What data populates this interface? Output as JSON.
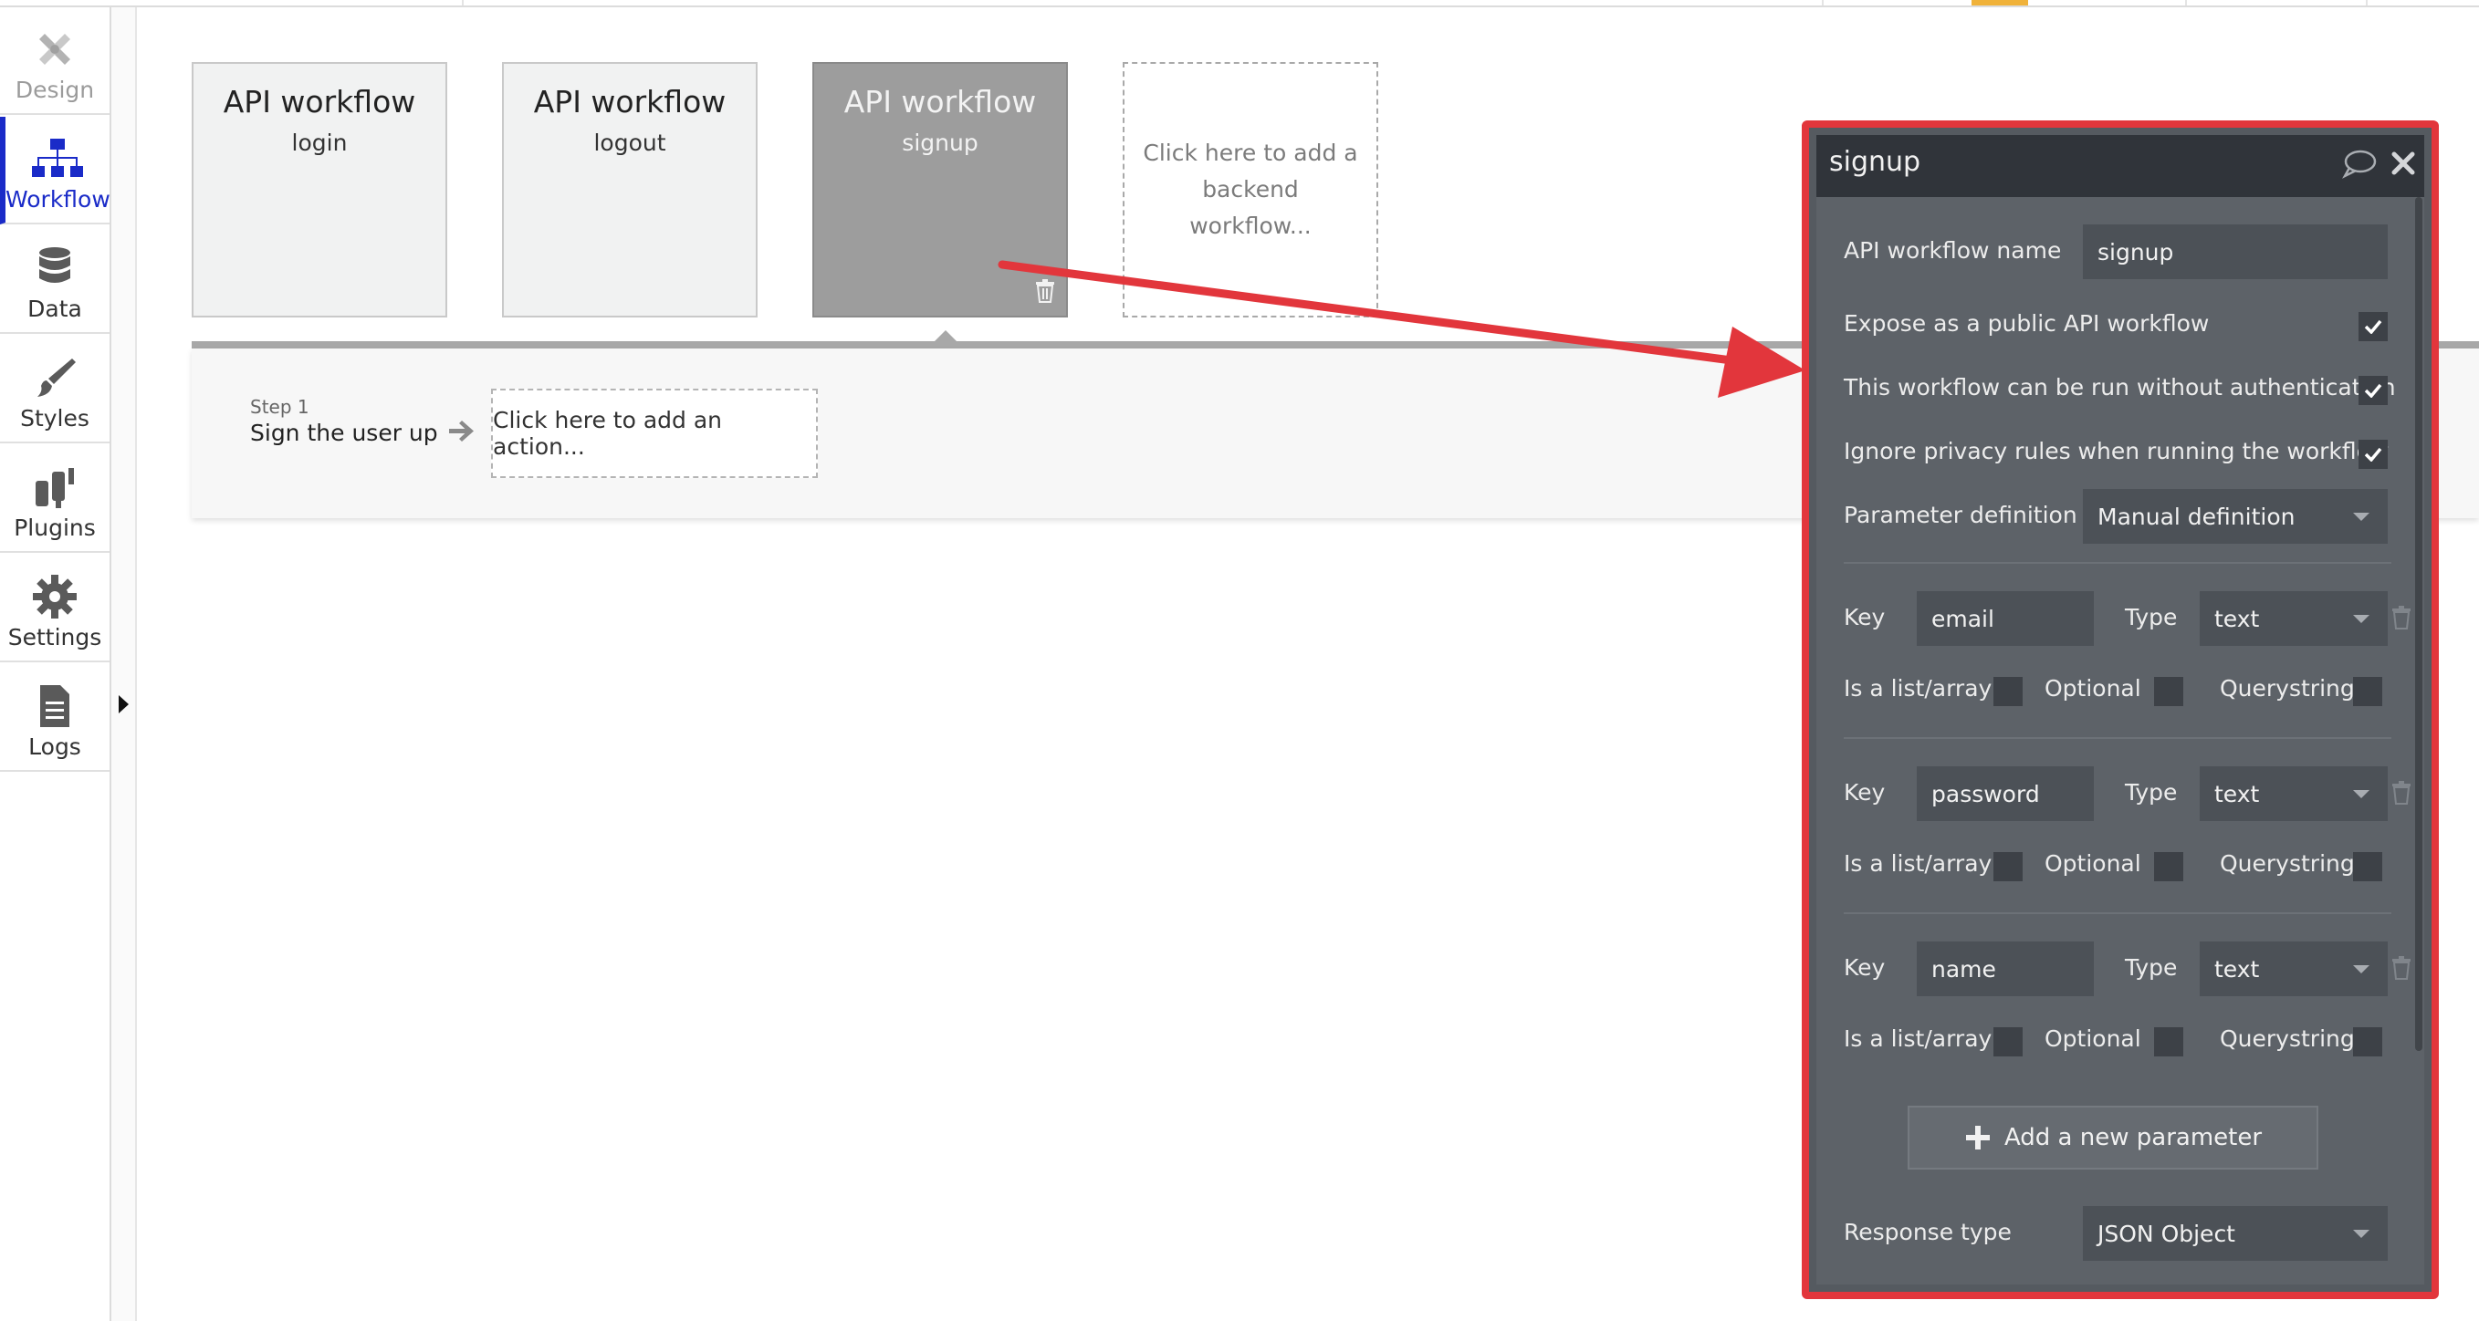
{
  "sidebar": {
    "items": [
      {
        "label": "Design",
        "icon": "design-icon"
      },
      {
        "label": "Workflow",
        "icon": "workflow-icon"
      },
      {
        "label": "Data",
        "icon": "database-icon"
      },
      {
        "label": "Styles",
        "icon": "brush-icon"
      },
      {
        "label": "Plugins",
        "icon": "plugin-icon"
      },
      {
        "label": "Settings",
        "icon": "gear-icon"
      },
      {
        "label": "Logs",
        "icon": "document-icon"
      }
    ],
    "active": "Workflow"
  },
  "workflows": [
    {
      "type": "API workflow",
      "name": "login"
    },
    {
      "type": "API workflow",
      "name": "logout"
    },
    {
      "type": "API workflow",
      "name": "signup",
      "selected": true
    }
  ],
  "add_workflow_text": "Click here to add a backend workflow...",
  "step": {
    "number": "Step 1",
    "title": "Sign the user up"
  },
  "add_action_text": "Click here to add an action...",
  "panel": {
    "title": "signup",
    "name_label": "API workflow name",
    "name_value": "signup",
    "expose_label": "Expose as a public API workflow",
    "no_auth_label": "This workflow can be run without authentication",
    "ignore_privacy_label": "Ignore privacy rules when running the workflow",
    "param_def_label": "Parameter definition",
    "param_def_value": "Manual definition",
    "key_label": "Key",
    "type_label": "Type",
    "list_label": "Is a list/array",
    "optional_label": "Optional",
    "query_label": "Querystring",
    "parameters": [
      {
        "key": "email",
        "type": "text"
      },
      {
        "key": "password",
        "type": "text"
      },
      {
        "key": "name",
        "type": "text"
      }
    ],
    "add_param_label": "Add a new parameter",
    "response_label": "Response type",
    "response_value": "JSON Object"
  },
  "colors": {
    "accent": "#1a2bc8",
    "highlight": "#e2363c",
    "panel_bg": "#5d6268",
    "panel_header": "#30343a"
  }
}
